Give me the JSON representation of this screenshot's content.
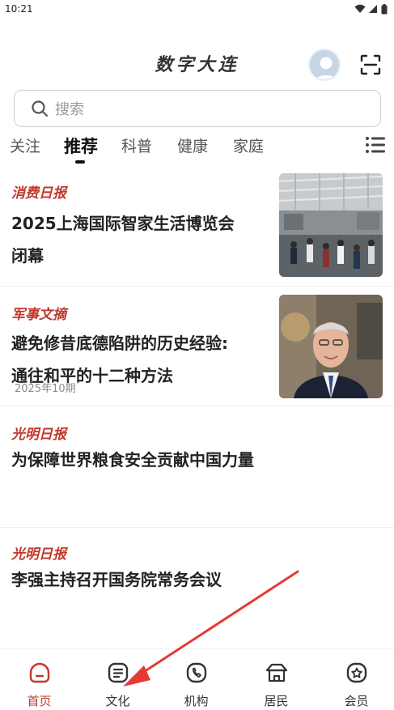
{
  "status_bar": {
    "time": "10:21"
  },
  "header": {
    "app_title": "数字大连"
  },
  "search": {
    "placeholder": "搜索"
  },
  "tabs": [
    {
      "label": "关注",
      "active": false
    },
    {
      "label": "推荐",
      "active": true
    },
    {
      "label": "科普",
      "active": false
    },
    {
      "label": "健康",
      "active": false
    },
    {
      "label": "家庭",
      "active": false
    }
  ],
  "feed": [
    {
      "source": "消费日报",
      "title_lines": [
        "2025上海国际智家生活博览会",
        "闭幕"
      ],
      "meta": "",
      "thumbnail": "expo-hall-photo"
    },
    {
      "source": "军事文摘",
      "title_lines": [
        "避免修昔底德陷阱的历史经验:",
        "通往和平的十二种方法"
      ],
      "meta": "2025年10期",
      "thumbnail": "portrait-photo"
    },
    {
      "source": "光明日报",
      "title_lines": [
        "为保障世界粮食安全贡献中国力量"
      ],
      "meta": "",
      "thumbnail": ""
    },
    {
      "source": "光明日报",
      "title_lines": [
        "李强主持召开国务院常务会议"
      ],
      "meta": "",
      "thumbnail": ""
    }
  ],
  "bottom_nav": [
    {
      "label": "首页",
      "icon": "home-icon",
      "active": true
    },
    {
      "label": "文化",
      "icon": "document-icon",
      "active": false
    },
    {
      "label": "机构",
      "icon": "phone-icon",
      "active": false
    },
    {
      "label": "居民",
      "icon": "residence-icon",
      "active": false
    },
    {
      "label": "会员",
      "icon": "member-icon",
      "active": false
    }
  ],
  "colors": {
    "accent": "#c0392b",
    "annotation_arrow": "#e53935"
  }
}
